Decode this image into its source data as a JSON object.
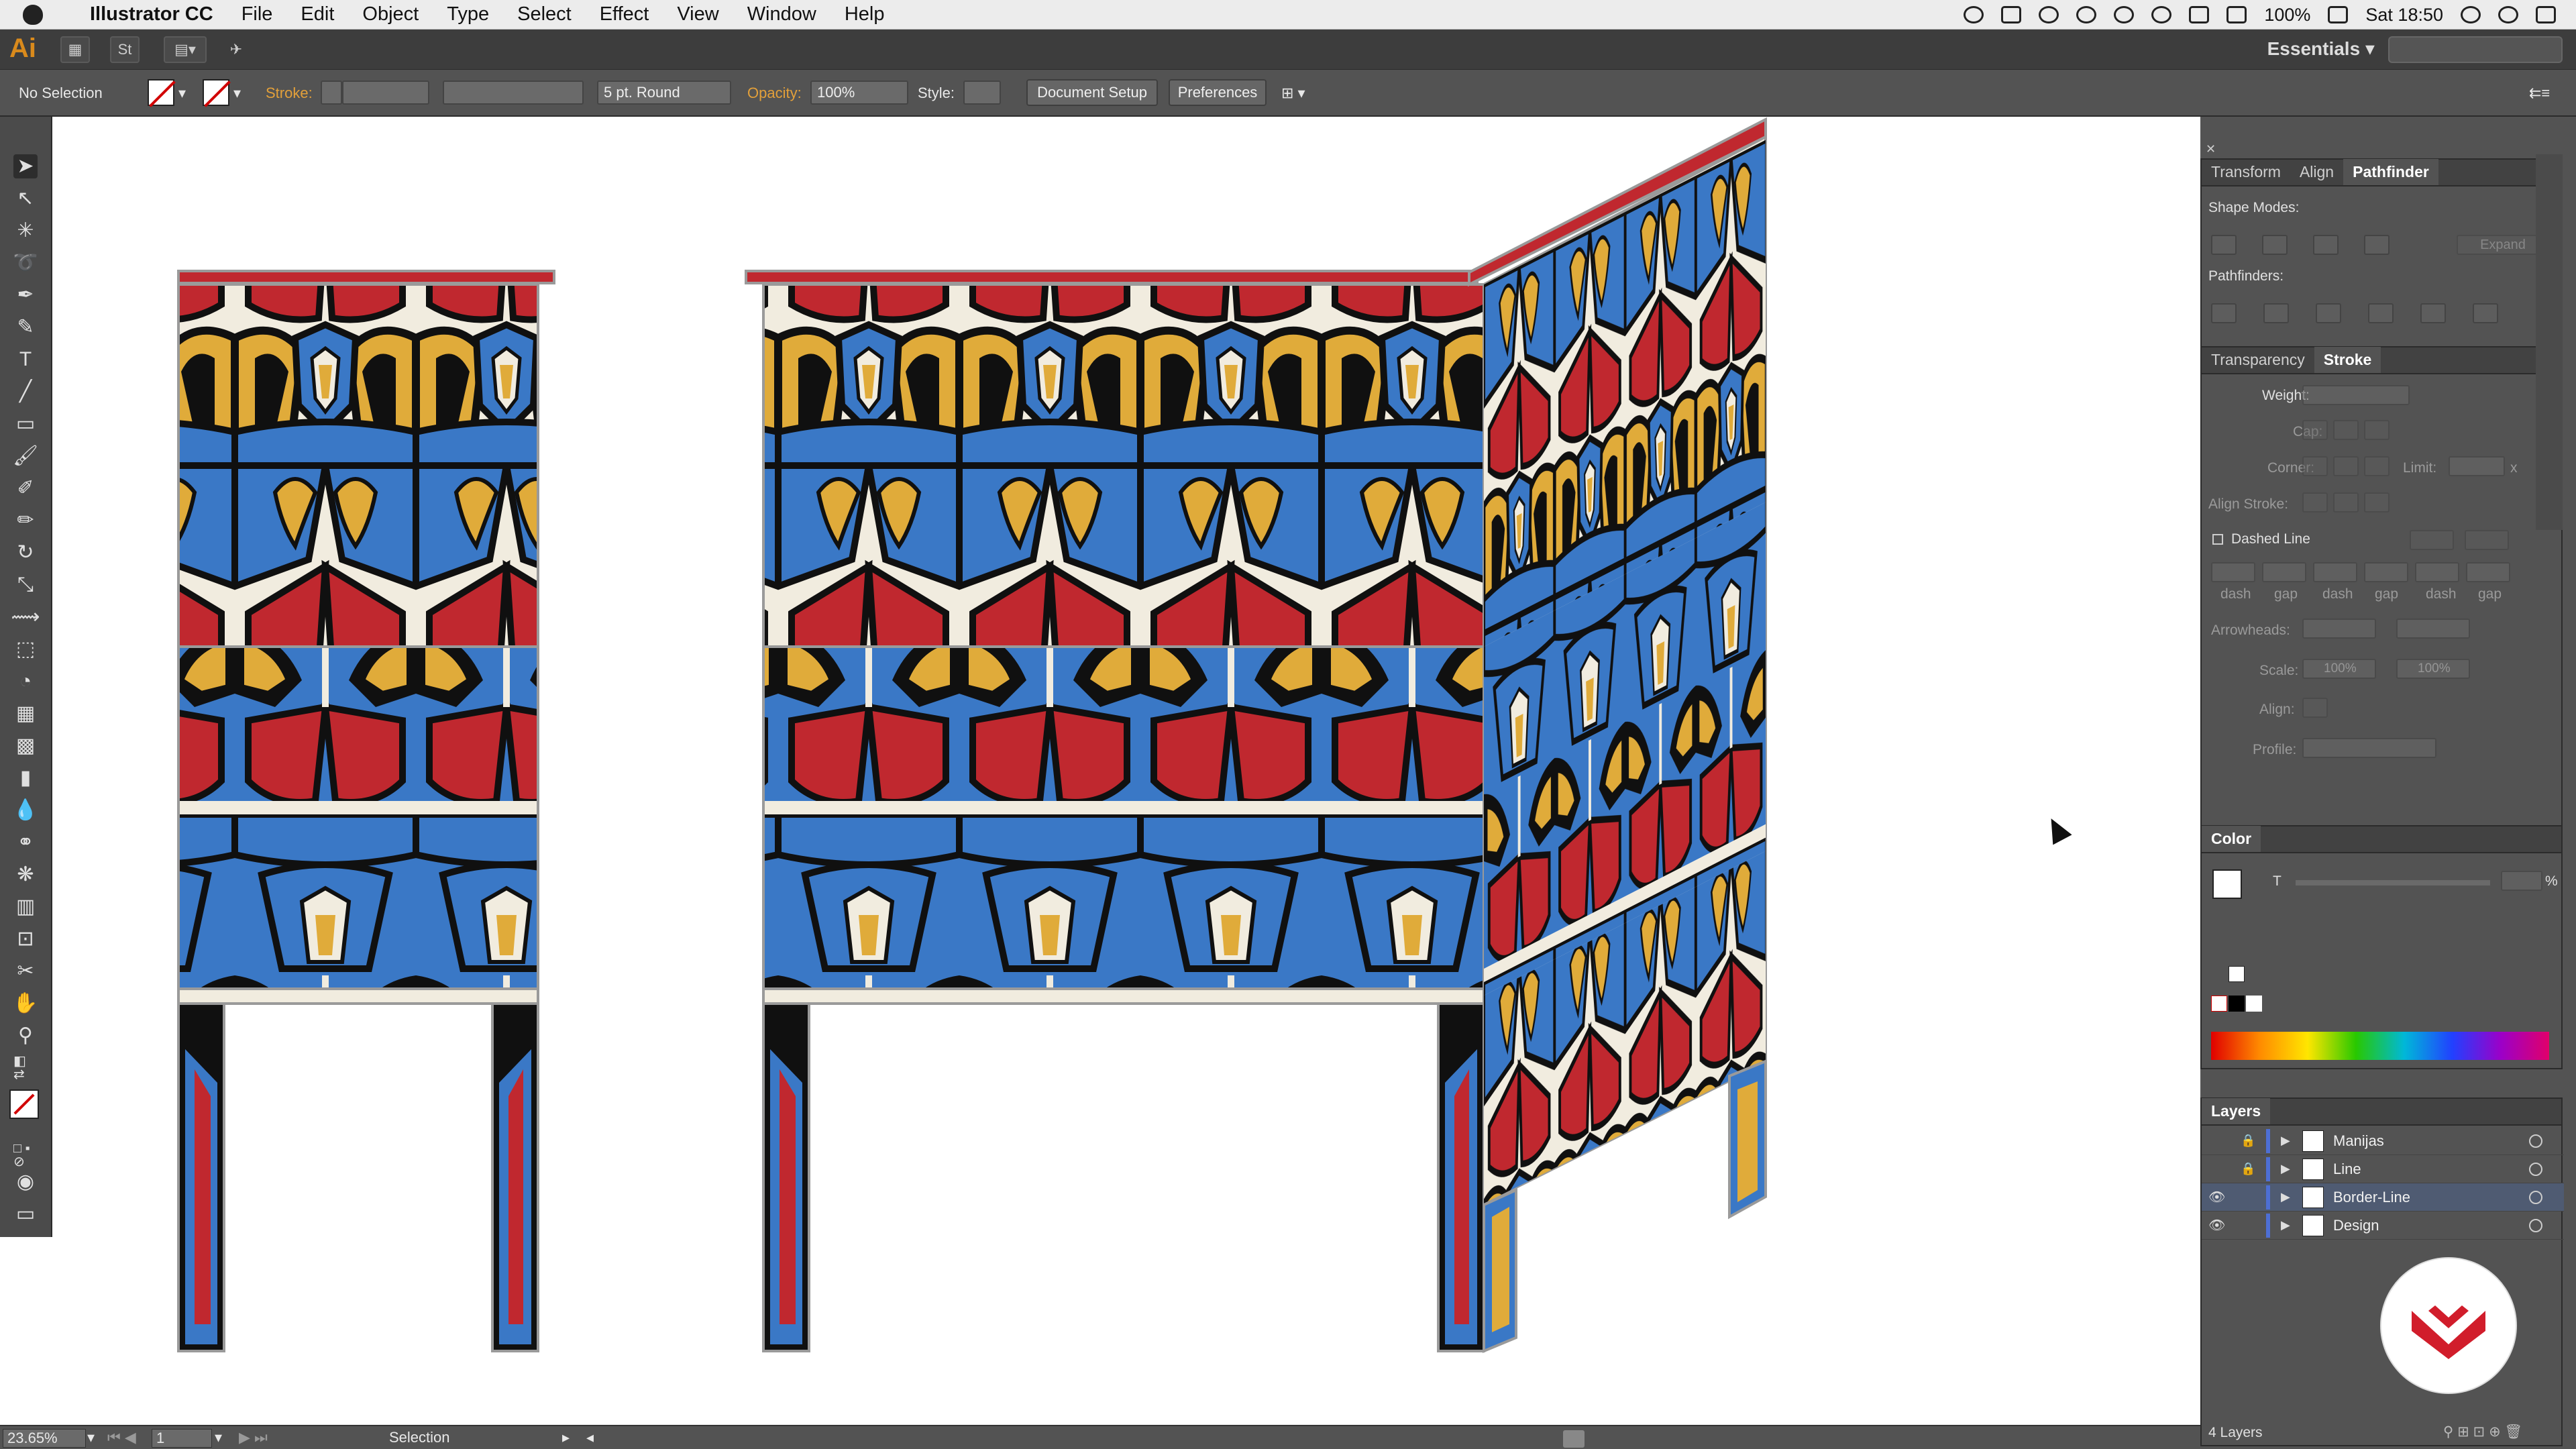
{
  "menubar": {
    "app_name": "Illustrator CC",
    "items": [
      "File",
      "Edit",
      "Object",
      "Type",
      "Select",
      "Effect",
      "View",
      "Window",
      "Help"
    ],
    "battery": "100%",
    "clock": "Sat 18:50"
  },
  "appbar": {
    "logo": "Ai",
    "bridge_label": "St",
    "workspace": "Essentials"
  },
  "controlbar": {
    "selection": "No Selection",
    "stroke_label": "Stroke:",
    "brush": "5 pt. Round",
    "opacity_label": "Opacity:",
    "opacity": "100%",
    "style_label": "Style:",
    "document_setup": "Document Setup",
    "preferences": "Preferences"
  },
  "pathfinder_panel": {
    "tabs": [
      "Transform",
      "Align",
      "Pathfinder"
    ],
    "shape_modes": "Shape Modes:",
    "expand": "Expand",
    "pathfinders": "Pathfinders:"
  },
  "stroke_panel": {
    "tabs": [
      "Transparency",
      "Stroke"
    ],
    "weight": "Weight:",
    "cap": "Cap:",
    "corner": "Corner:",
    "limit": "Limit:",
    "limit_x": "x",
    "align_stroke": "Align Stroke:",
    "dashed_line": "Dashed Line",
    "dash_labels": [
      "dash",
      "gap",
      "dash",
      "gap",
      "dash",
      "gap"
    ],
    "arrowheads": "Arrowheads:",
    "scale": "Scale:",
    "scale_value": "100%",
    "align": "Align:",
    "profile": "Profile:"
  },
  "color_panel": {
    "title": "Color",
    "channel": "T",
    "percent": "%"
  },
  "layers_panel": {
    "title": "Layers",
    "layers": [
      {
        "name": "Manijas",
        "locked": true,
        "visible": false
      },
      {
        "name": "Line",
        "locked": true,
        "visible": false
      },
      {
        "name": "Border-Line",
        "locked": false,
        "visible": true,
        "selected": true
      },
      {
        "name": "Design",
        "locked": false,
        "visible": true
      }
    ],
    "count": "4 Layers"
  },
  "statusbar": {
    "zoom": "23.65%",
    "artboard": "1",
    "tool": "Selection"
  },
  "colors": {
    "blue": "#3a78c6",
    "red": "#c0282f",
    "yellow": "#e0ab3a",
    "cream": "#f1ecdf",
    "black": "#101010",
    "logo_red": "#d11d2b"
  }
}
